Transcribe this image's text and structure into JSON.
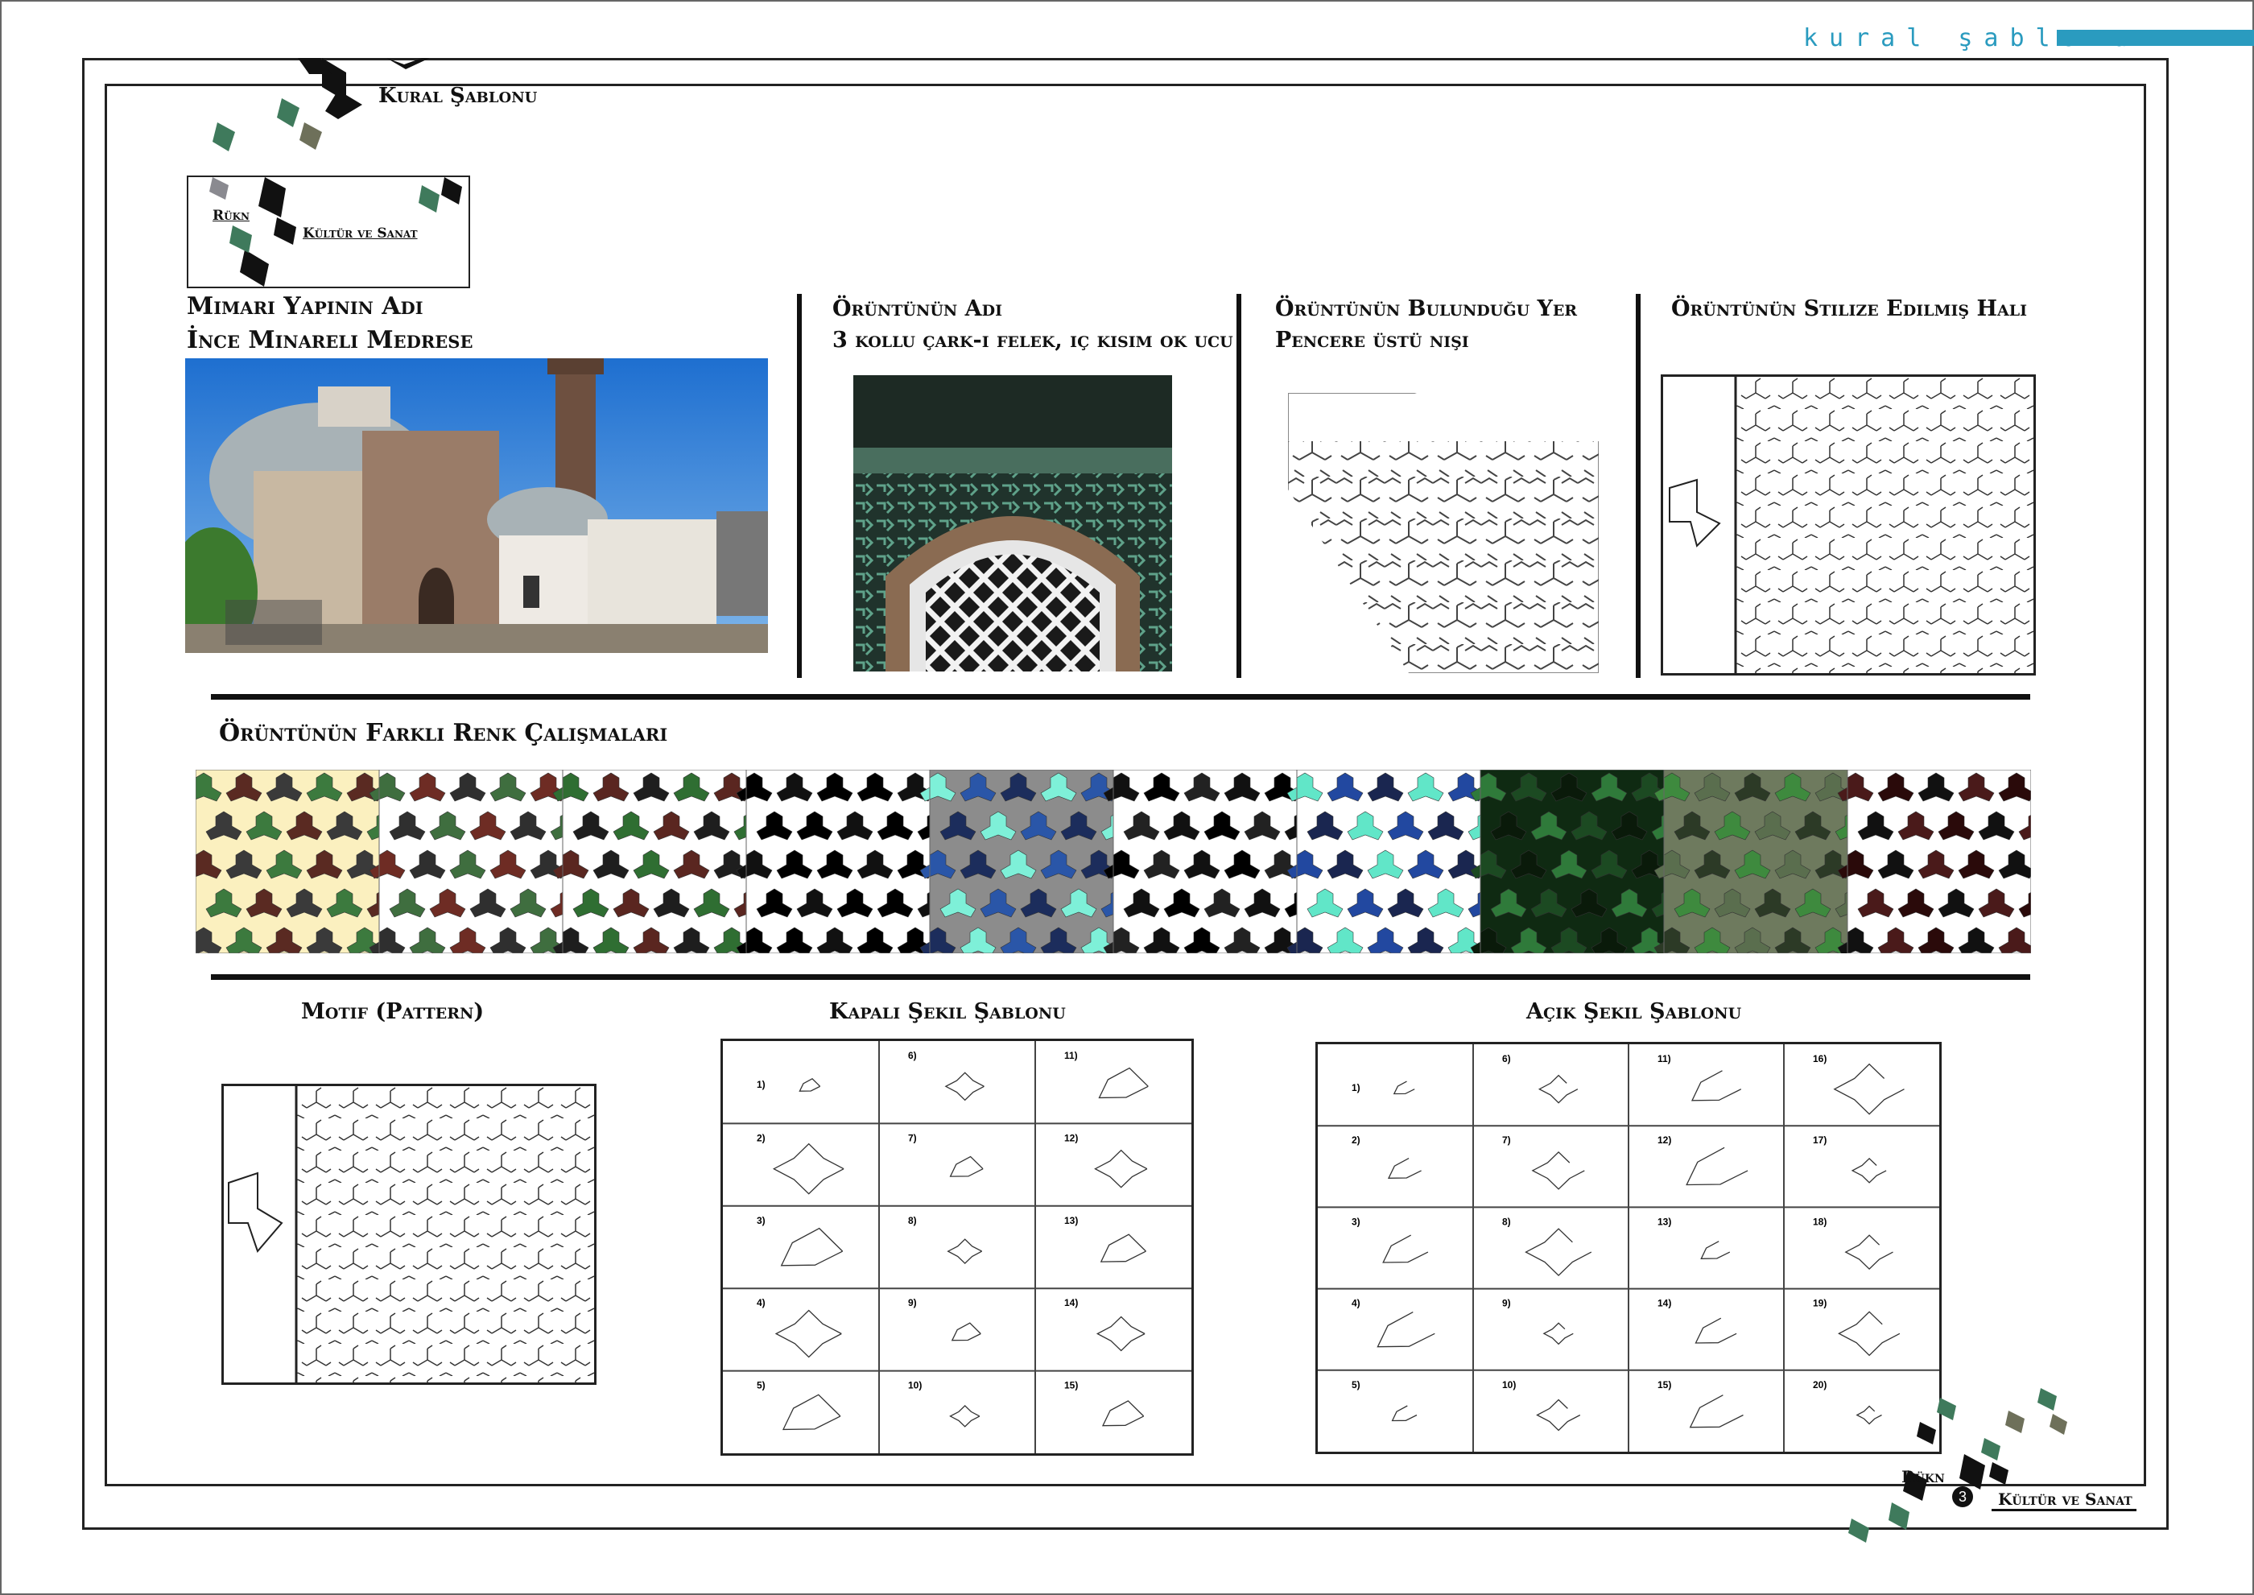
{
  "sheet_title": "kural şablonu",
  "header": {
    "logo_title": "Kural Şablonu"
  },
  "logo_box": {
    "word1": "Rükn",
    "word2": "Kültür ve Sanat"
  },
  "building": {
    "label": "Mimari Yapının Adı",
    "value": "İnce Minareli Medrese"
  },
  "pattern_name": {
    "label": "Örüntünün Adı",
    "value": "3 kollu çark-ı felek, iç kısım ok ucu"
  },
  "pattern_location": {
    "label": "Örüntünün Bulunduğu Yer",
    "value": "Pencere üstü nişi"
  },
  "pattern_stylized": {
    "label": "Örüntünün Stilize Edilmiş Hali"
  },
  "color_studies": {
    "label": "Örüntünün Farklı Renk Çalışmaları",
    "swatches": [
      {
        "bg": "#fbf0bf",
        "a": "#3c7a3e",
        "b": "#5a2a22",
        "c": "#3a3a3a"
      },
      {
        "bg": "#ffffff",
        "a": "#3f6e3f",
        "b": "#6e2c24",
        "c": "#2f2f2f"
      },
      {
        "bg": "#ffffff",
        "a": "#2f6e32",
        "b": "#5a2620",
        "c": "#1e1e1e"
      },
      {
        "bg": "#ffffff",
        "a": "#000000",
        "b": "#111111",
        "c": "#000000"
      },
      {
        "bg": "#8c8c8c",
        "a": "#7ef0d8",
        "b": "#2a56a8",
        "c": "#1c2d5c"
      },
      {
        "bg": "#ffffff",
        "a": "#111111",
        "b": "#000000",
        "c": "#222222"
      },
      {
        "bg": "#ffffff",
        "a": "#61e6c8",
        "b": "#2248a0",
        "c": "#1a2650"
      },
      {
        "bg": "#0f2a12",
        "a": "#2f7a3a",
        "b": "#1c4a22",
        "c": "#0a1a0a"
      },
      {
        "bg": "#6e7a5e",
        "a": "#3e8a3e",
        "b": "#5a6e4e",
        "c": "#2c3a26"
      },
      {
        "bg": "#ffffff",
        "a": "#4a1a1a",
        "b": "#2a0a0a",
        "c": "#111111"
      }
    ]
  },
  "motif": {
    "label": "Motif (Pattern)"
  },
  "closed_shapes": {
    "label": "Kapalı Şekil Şablonu",
    "numbers": [
      "1)",
      "6)",
      "11)",
      "2)",
      "7)",
      "12)",
      "3)",
      "8)",
      "13)",
      "4)",
      "9)",
      "14)",
      "5)",
      "10)",
      "15)"
    ]
  },
  "open_shapes": {
    "label": "Açık Şekil Şablonu",
    "numbers": [
      "1)",
      "6)",
      "11)",
      "16)",
      "2)",
      "7)",
      "12)",
      "17)",
      "3)",
      "8)",
      "13)",
      "18)",
      "4)",
      "9)",
      "14)",
      "19)",
      "5)",
      "10)",
      "15)",
      "20)"
    ]
  },
  "footer": {
    "word1": "Rükn",
    "page_number": "3",
    "word2": "Kültür ve Sanat"
  },
  "colors": {
    "accent": "#2a9bbf",
    "logo_dark": "#111111",
    "logo_green": "#3f7a5c",
    "logo_olive": "#7a7a60"
  }
}
